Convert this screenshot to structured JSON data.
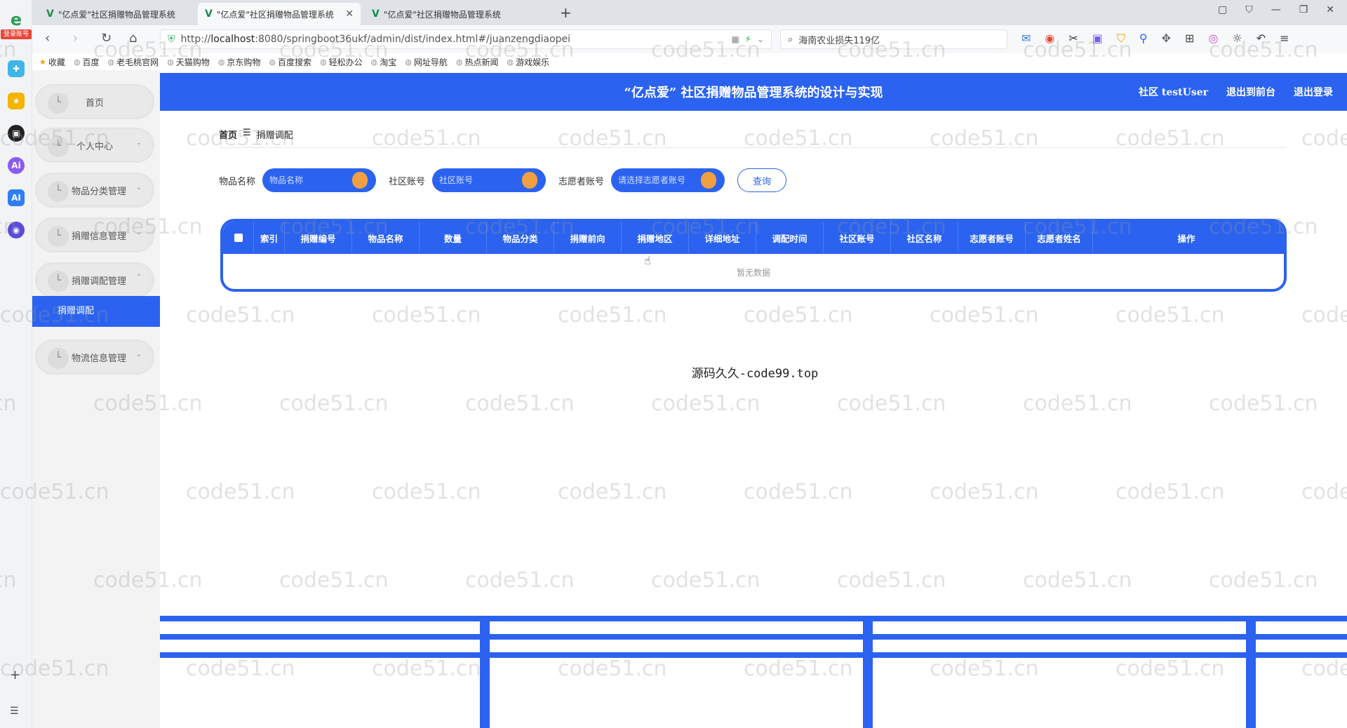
{
  "browser": {
    "tabs": [
      {
        "title": "\"亿点爱\"社区捐赠物品管理系统",
        "active": false
      },
      {
        "title": "\"亿点爱\"社区捐赠物品管理系统",
        "active": true
      },
      {
        "title": "\"亿点爱\"社区捐赠物品管理系统",
        "active": false
      }
    ],
    "url_prefix": "http://",
    "url_host": "localhost",
    "url_rest": ":8080/springboot36ukf/admin/dist/index.html#/juanzengdiaopei",
    "search_text": "海南农业损失119亿",
    "dock_login": "登录账号",
    "bookmarks": [
      "收藏",
      "百度",
      "老毛桃官网",
      "天猫购物",
      "京东购物",
      "百度搜索",
      "轻松办公",
      "淘宝",
      "网址导航",
      "热点新闻",
      "游戏娱乐"
    ]
  },
  "app": {
    "title": "“亿点爱” 社区捐赠物品管理系统的设计与实现",
    "top_links": [
      "社区 testUser",
      "退出到前台",
      "退出登录"
    ],
    "menu": [
      {
        "label": "首页",
        "has_arrow": false
      },
      {
        "label": "个人中心",
        "has_arrow": true
      },
      {
        "label": "物品分类管理",
        "has_arrow": true
      },
      {
        "label": "捐赠信息管理",
        "has_arrow": true
      },
      {
        "label": "捐赠调配管理",
        "has_arrow": true,
        "expanded": true
      },
      {
        "label": "物流信息管理",
        "has_arrow": true
      }
    ],
    "active_submenu": "捐赠调配",
    "breadcrumb": {
      "home": "首页",
      "sep": "☰",
      "current": "捐赠调配"
    },
    "filters": [
      {
        "label": "物品名称",
        "placeholder": "物品名称"
      },
      {
        "label": "社区账号",
        "placeholder": "社区账号"
      },
      {
        "label": "志愿者账号",
        "placeholder": "请选择志愿者账号"
      }
    ],
    "query_label": "查询",
    "table": {
      "columns": [
        "索引",
        "捐赠编号",
        "物品名称",
        "数量",
        "物品分类",
        "捐赠前向",
        "捐赠地区",
        "详细地址",
        "调配时间",
        "社区账号",
        "社区名称",
        "志愿者账号",
        "志愿者姓名",
        "操作"
      ],
      "empty_text": "暂无数据"
    },
    "source_text": "源码久久-code99.top"
  },
  "watermark": "code51.cn"
}
